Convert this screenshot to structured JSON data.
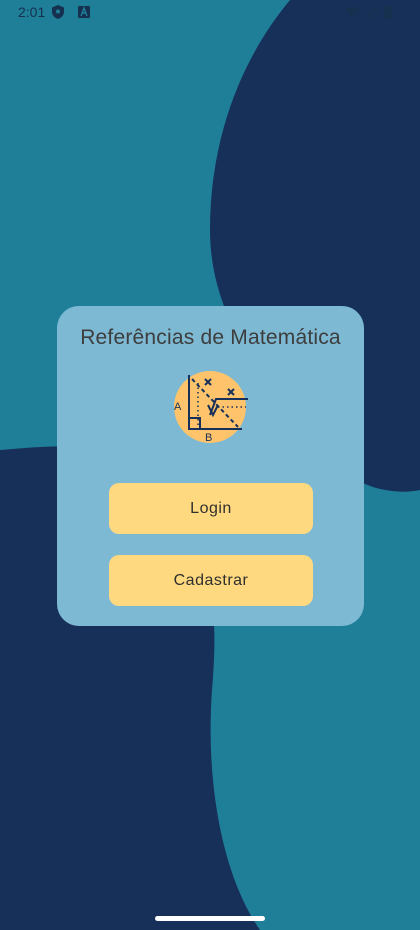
{
  "status_bar": {
    "time": "2:01",
    "icons": [
      "shield-icon",
      "font-icon",
      "wifi-icon",
      "signal-icon",
      "battery-icon"
    ]
  },
  "card": {
    "title": "Referências de Matemática",
    "logo_icon": "geometry-logo-icon",
    "logo_labels": {
      "a": "A",
      "b": "B"
    }
  },
  "buttons": {
    "login_label": "Login",
    "register_label": "Cadastrar"
  },
  "colors": {
    "background_teal": "#1f7f99",
    "background_navy": "#17305a",
    "card": "#7db9d3",
    "button": "#ffd97f",
    "logo_circle": "#ffc46b"
  }
}
